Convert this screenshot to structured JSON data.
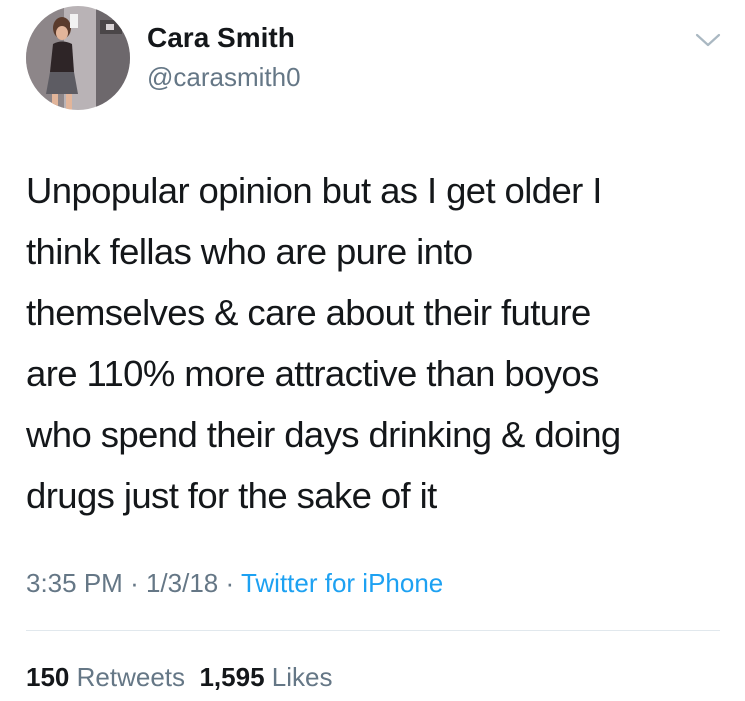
{
  "tweet": {
    "author": {
      "display_name": "Cara Smith",
      "handle": "@carasmith0"
    },
    "text": "Unpopular opinion but as I get older I\nthink fellas who are pure into\nthemselves & care about their future\nare 110% more attractive than boyos\nwho spend their days drinking & doing\ndrugs just for the sake of it",
    "time": "3:35 PM",
    "date": "1/3/18",
    "separator": "·",
    "source": "Twitter for iPhone",
    "retweets_count": "150",
    "retweets_label": "Retweets",
    "likes_count": "1,595",
    "likes_label": "Likes"
  },
  "icons": {
    "menu": "chevron-down-icon",
    "avatar": "avatar-image"
  },
  "colors": {
    "text": "#14171a",
    "secondary": "#657786",
    "link": "#1da1f2",
    "divider": "#e1e8ed"
  }
}
